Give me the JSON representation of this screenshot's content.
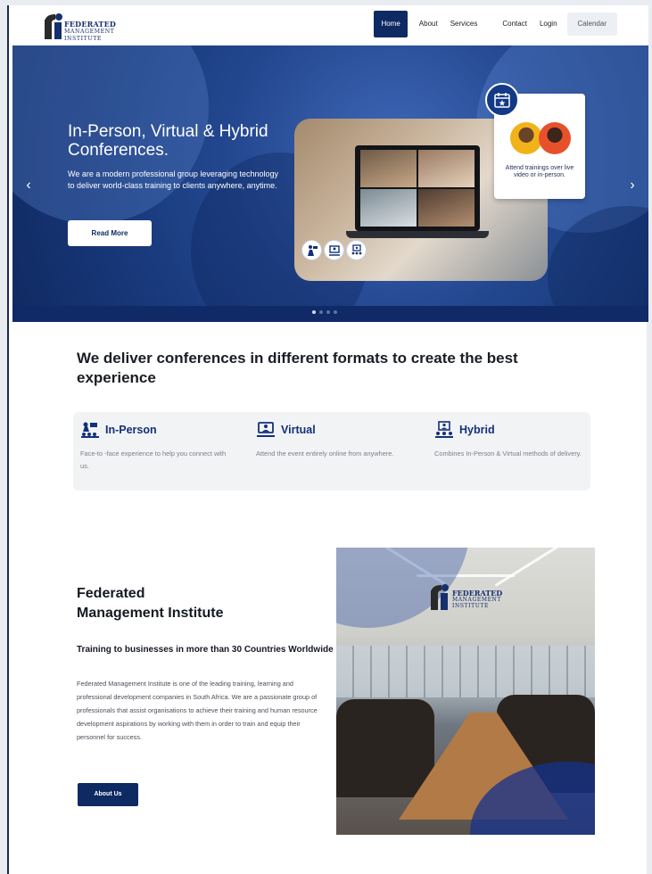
{
  "brand": {
    "name_line1": "FEDERATED",
    "name_line2": "MANAGEMENT",
    "name_line3": "INSTITUTE",
    "color_primary": "#0e2a63"
  },
  "nav": {
    "items": [
      "Home",
      "About",
      "Services",
      "Contact",
      "Login",
      "Calendar"
    ],
    "active": "Home"
  },
  "hero": {
    "title": "In-Person, Virtual & Hybrid Conferences.",
    "text": "We are a modern professional group leveraging technology to deliver world-class training to clients anywhere, anytime.",
    "button": "Read More",
    "card_text": "Attend trainings over live video or in-person.",
    "prev_icon": "chevron-left-icon",
    "next_icon": "chevron-right-icon",
    "slides": 4,
    "active_slide": 1
  },
  "formats": {
    "title": "We deliver conferences in different formats to create the best experience",
    "items": [
      {
        "name": "In-Person",
        "desc": "Face-to -face experience to help you connect with us.",
        "icon": "presenter-icon"
      },
      {
        "name": "Virtual",
        "desc": "Attend the event entirely online from anywhere.",
        "icon": "video-call-icon"
      },
      {
        "name": "Hybrid",
        "desc": "Combines In-Person & Virtual methods of delivery.",
        "icon": "hybrid-audience-icon"
      }
    ]
  },
  "about": {
    "title_line1": "Federated",
    "title_line2": "Management Institute",
    "subtitle": "Training to businesses in more than 30 Countries Worldwide",
    "text": "Federated Management Institute is one of the leading training, learning and professional development companies in South Africa. We are a passionate group of professionals that assist organisations to achieve their training and human resource development aspirations by working with them in order to train and equip their personnel for success.",
    "button": "About Us"
  }
}
